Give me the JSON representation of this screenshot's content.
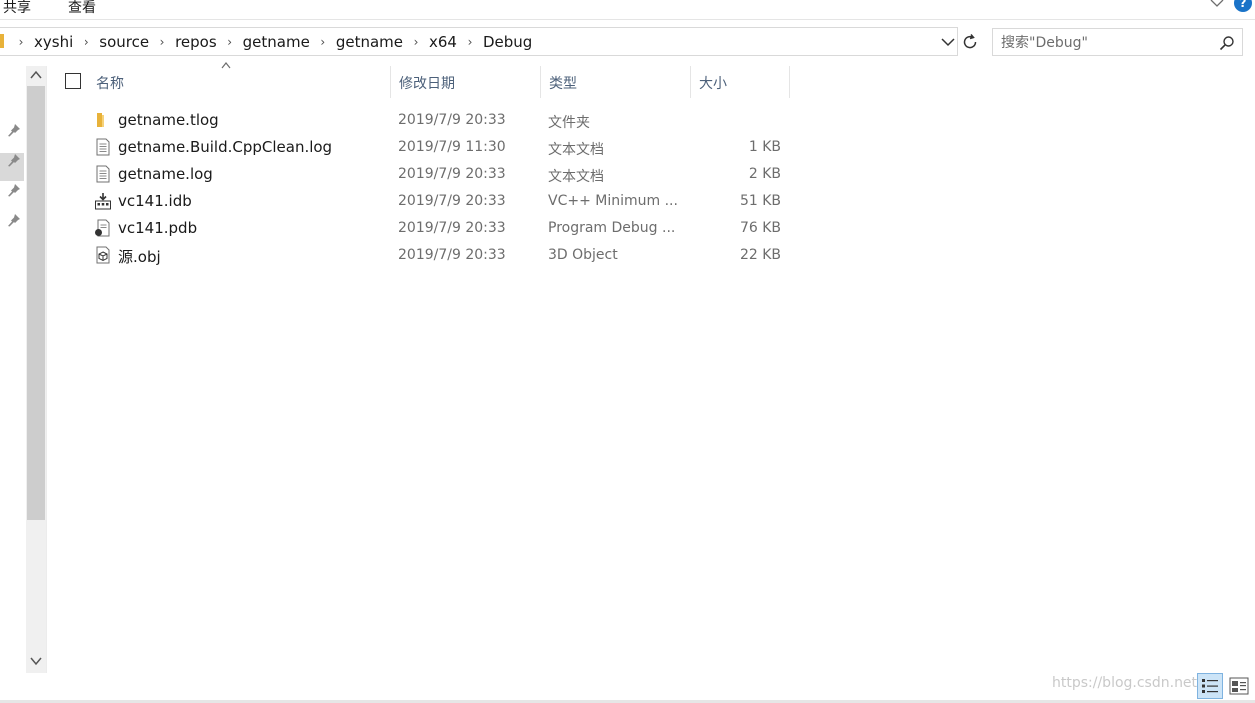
{
  "ribbon": {
    "tabs": [
      "共享",
      "查看"
    ],
    "help_label": "?"
  },
  "address": {
    "crumbs": [
      "xyshi",
      "source",
      "repos",
      "getname",
      "getname",
      "x64",
      "Debug"
    ]
  },
  "search": {
    "placeholder": "搜索\"Debug\""
  },
  "columns": {
    "name": "名称",
    "date": "修改日期",
    "type": "类型",
    "size": "大小"
  },
  "files": [
    {
      "icon": "folder-icon",
      "name": "getname.tlog",
      "date": "2019/7/9 20:33",
      "type": "文件夹",
      "size": ""
    },
    {
      "icon": "text-file-icon",
      "name": "getname.Build.CppClean.log",
      "date": "2019/7/9 11:30",
      "type": "文本文档",
      "size": "1 KB"
    },
    {
      "icon": "text-file-icon",
      "name": "getname.log",
      "date": "2019/7/9 20:33",
      "type": "文本文档",
      "size": "2 KB"
    },
    {
      "icon": "idb-file-icon",
      "name": "vc141.idb",
      "date": "2019/7/9 20:33",
      "type": "VC++ Minimum ...",
      "size": "51 KB"
    },
    {
      "icon": "pdb-file-icon",
      "name": "vc141.pdb",
      "date": "2019/7/9 20:33",
      "type": "Program Debug ...",
      "size": "76 KB"
    },
    {
      "icon": "3d-object-icon",
      "name": "源.obj",
      "date": "2019/7/9 20:33",
      "type": "3D Object",
      "size": "22 KB"
    }
  ],
  "watermark": "https://blog.csdn.net/",
  "colors": {
    "header_text": "#4c607a",
    "folder": "#e8b23a",
    "accent": "#1a73c8"
  }
}
